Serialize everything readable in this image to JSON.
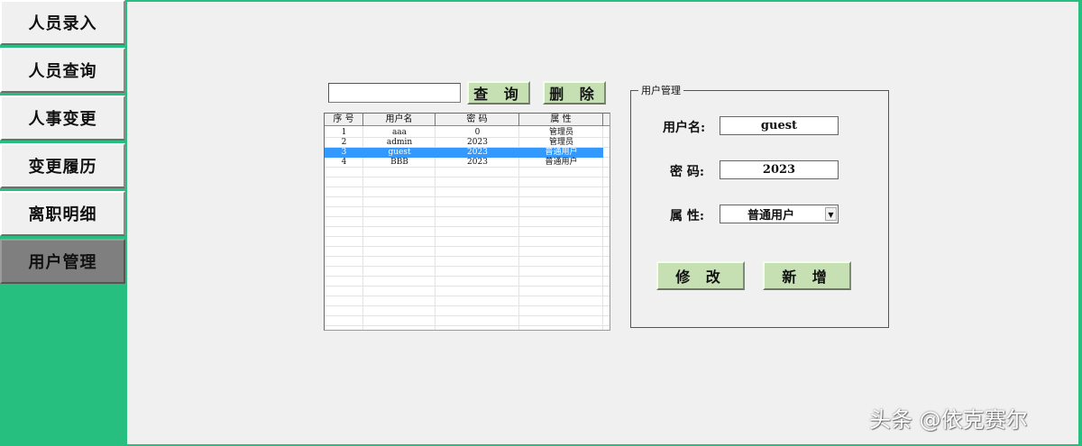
{
  "sidebar": {
    "items": [
      {
        "label": "人员录入"
      },
      {
        "label": "人员查询"
      },
      {
        "label": "人事变更"
      },
      {
        "label": "变更履历"
      },
      {
        "label": "离职明细"
      },
      {
        "label": "用户管理",
        "active": true
      }
    ]
  },
  "search": {
    "value": "",
    "query_label": "查 询",
    "delete_label": "删 除"
  },
  "list": {
    "columns": [
      "序 号",
      "用户名",
      "密 码",
      "属 性"
    ],
    "rows": [
      [
        "1",
        "aaa",
        "0",
        "管理员"
      ],
      [
        "2",
        "admin",
        "2023",
        "管理员"
      ],
      [
        "3",
        "guest",
        "2023",
        "普通用户"
      ],
      [
        "4",
        "BBB",
        "2023",
        "普通用户"
      ]
    ],
    "selected_index": 2
  },
  "user_panel": {
    "title": "用户管理",
    "username_label": "用户名:",
    "username_value": "guest",
    "password_label": "密 码:",
    "password_value": "2023",
    "attr_label": "属 性:",
    "attr_value": "普通用户",
    "modify_label": "修 改",
    "add_label": "新 增"
  },
  "watermark": "头条 @依克赛尔",
  "colors": {
    "sidebar_bg": "#26bf7f",
    "button_green": "#c6e0b4",
    "selection": "#3399ff"
  }
}
